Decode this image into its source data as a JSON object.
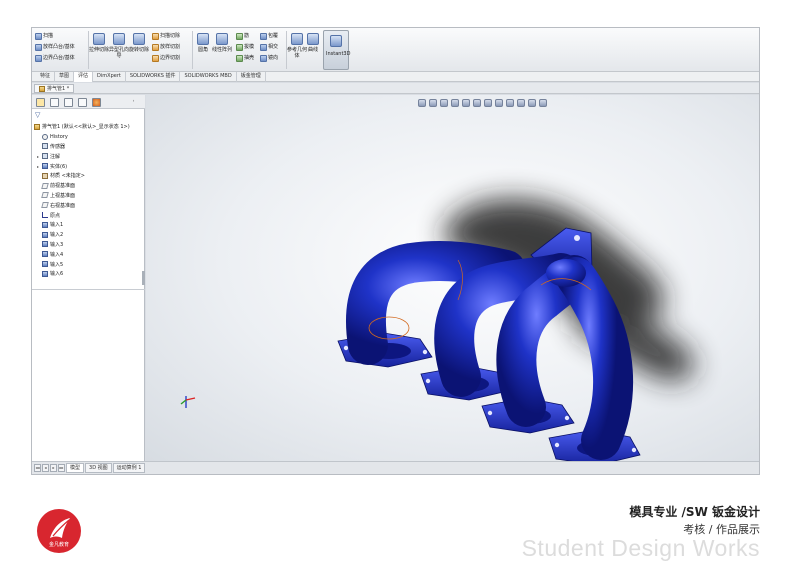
{
  "ribbon": {
    "group1": [
      "扫描",
      "放样凸台/基体",
      "边界凸台/基体"
    ],
    "group2_big": [
      "拉伸切除",
      "异型孔向导",
      "旋转切除"
    ],
    "group3": [
      "扫描切除",
      "放样切割",
      "边界切割"
    ],
    "group4_big": [
      "圆角",
      "线性阵列"
    ],
    "group5": [
      "筋",
      "拔模",
      "抽壳"
    ],
    "group6": [
      "包覆",
      "相交",
      "镜向"
    ],
    "group7_big": [
      "参考几何体",
      "曲线"
    ],
    "instant3d": "Instant3D"
  },
  "tabs": [
    "特征",
    "草图",
    "评估",
    "DimXpert",
    "SOLIDWORKS 插件",
    "SOLIDWORKS MBD",
    "钣金管理"
  ],
  "document": {
    "tab_label": "排气管1 *"
  },
  "feature_tree": {
    "root": "排气管1 (默认<<默认>_显示状态 1>)",
    "items": [
      {
        "label": "History",
        "icon": "history-icon",
        "expand": ""
      },
      {
        "label": "传感器",
        "icon": "sensor-icon",
        "expand": ""
      },
      {
        "label": "注解",
        "icon": "annotation-icon",
        "expand": "▸"
      },
      {
        "label": "实体(6)",
        "icon": "solid-bodies-icon",
        "expand": "▸"
      },
      {
        "label": "材质 <未指定>",
        "icon": "material-icon",
        "expand": ""
      },
      {
        "label": "前视基准面",
        "icon": "plane-icon",
        "expand": ""
      },
      {
        "label": "上视基准面",
        "icon": "plane-icon",
        "expand": ""
      },
      {
        "label": "右视基准面",
        "icon": "plane-icon",
        "expand": ""
      },
      {
        "label": "原点",
        "icon": "origin-icon",
        "expand": ""
      },
      {
        "label": "输入1",
        "icon": "import-feature-icon",
        "expand": ""
      },
      {
        "label": "输入2",
        "icon": "import-feature-icon",
        "expand": ""
      },
      {
        "label": "输入3",
        "icon": "import-feature-icon",
        "expand": ""
      },
      {
        "label": "输入4",
        "icon": "import-feature-icon",
        "expand": ""
      },
      {
        "label": "输入5",
        "icon": "import-feature-icon",
        "expand": ""
      },
      {
        "label": "输入6",
        "icon": "import-feature-icon",
        "expand": ""
      }
    ]
  },
  "bottom_tabs": [
    "模型",
    "3D 视图",
    "运动算例 1"
  ],
  "nav_buttons": [
    "◂◂",
    "◂",
    "▸",
    "▸▸"
  ],
  "footer": {
    "logo_text": "金凡教育",
    "title": "模具专业 /SW 钣金设计",
    "subtitle": "考核 / 作品展示",
    "english": "Student Design Works"
  },
  "colors": {
    "part_blue": "#1f33c8",
    "part_highlight": "#6f7dff",
    "logo_red": "#d8262f"
  }
}
